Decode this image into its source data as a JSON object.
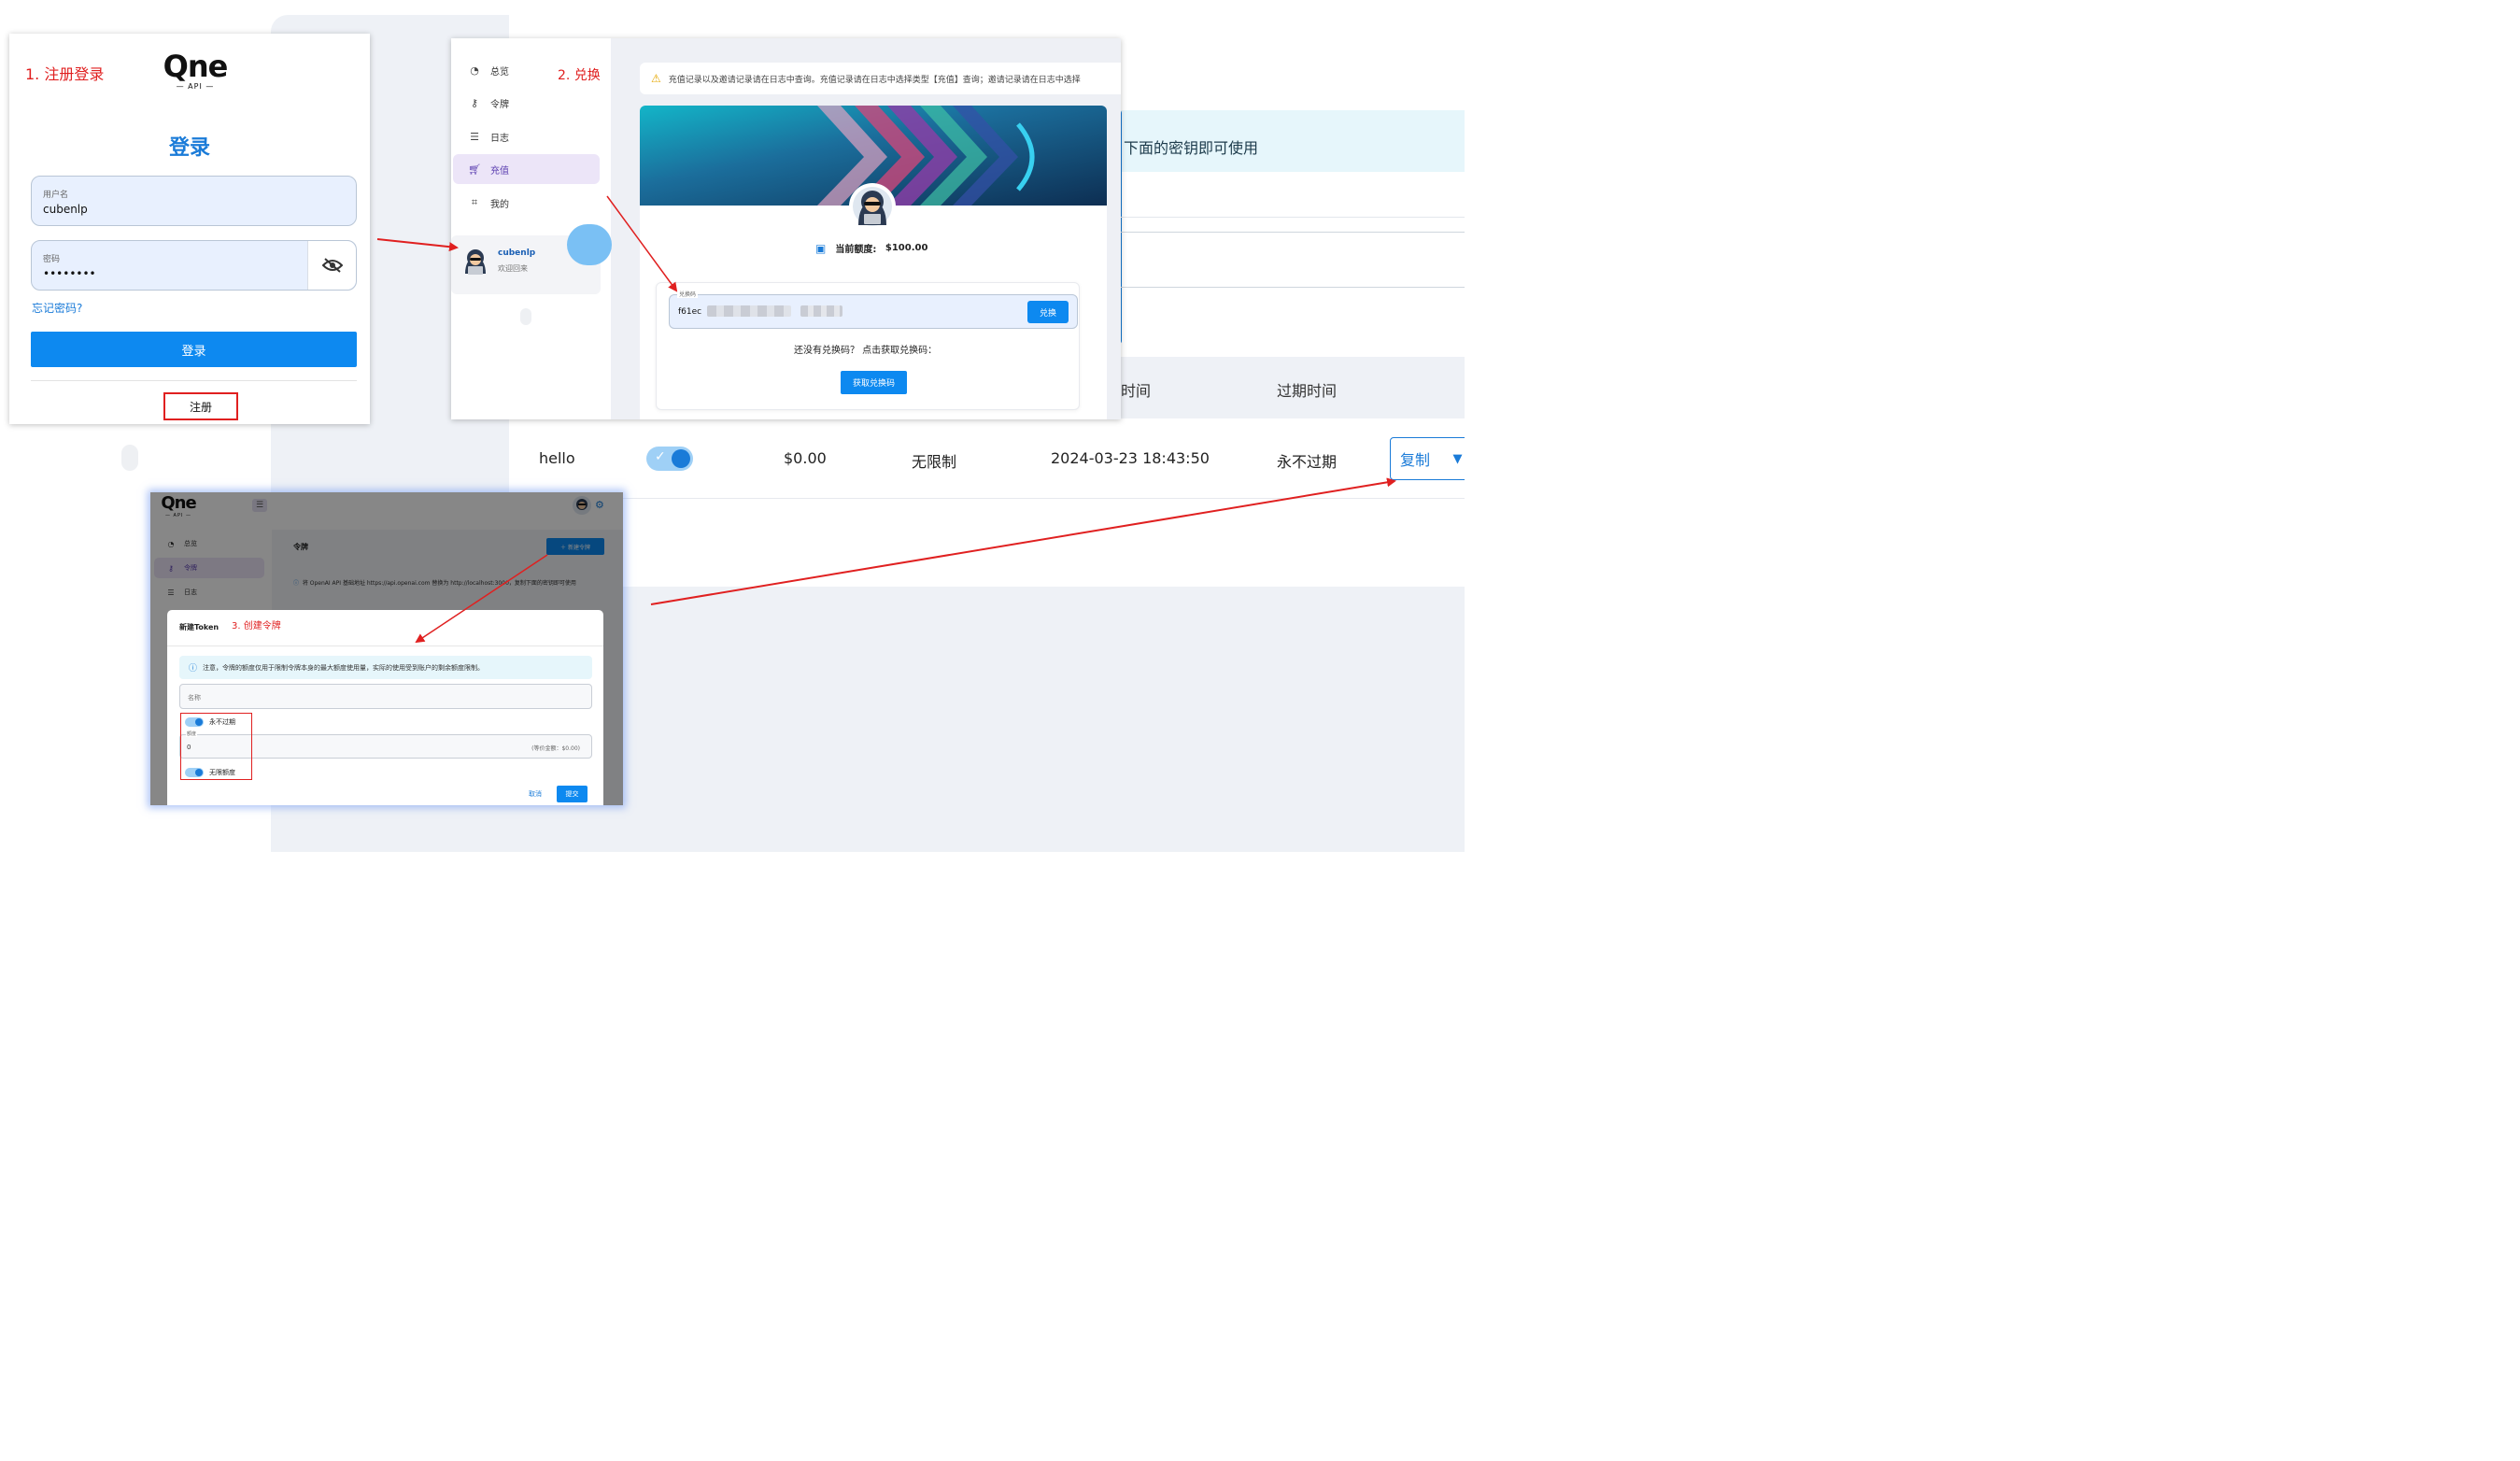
{
  "background": {
    "info_text": "下面的密钥即可使用",
    "table_headers": [
      "时间",
      "过期时间"
    ],
    "row": {
      "name": "hello",
      "used_quota": "$0.00",
      "remaining": "无限制",
      "created": "2024-03-23 18:43:50",
      "expires": "永不过期",
      "copy_label": "复制",
      "status_enabled": true
    }
  },
  "login": {
    "step": "1. 注册登录",
    "logo_text": "Qne",
    "logo_sub": "— API —",
    "title": "登录",
    "username_label": "用户名",
    "username_value": "cubenlp",
    "password_label": "密码",
    "password_value": "••••••••",
    "forgot": "忘记密码?",
    "login_button": "登录",
    "register": "注册"
  },
  "recharge": {
    "step": "2. 兑换",
    "nav": [
      "总览",
      "令牌",
      "日志",
      "充值",
      "我的"
    ],
    "nav_icons": [
      "dashboard-icon",
      "key-icon",
      "list-icon",
      "cart-icon",
      "user-scan-icon"
    ],
    "active_nav": "充值",
    "user_name": "cubenlp",
    "user_welcome": "欢迎回来",
    "notice": "充值记录以及邀请记录请在日志中查询。充值记录请在日志中选择类型【充值】查询；邀请记录请在日志中选择",
    "balance_label": "当前额度:",
    "balance_value": "$100.00",
    "code_label": "兑换码",
    "code_value": "f61ec",
    "redeem_button": "兑换",
    "no_code_text": "还没有兑换码？ 点击获取兑换码：",
    "get_code_button": "获取兑换码"
  },
  "token": {
    "logo_text": "Qne",
    "logo_sub": "— API —",
    "nav": [
      "总览",
      "令牌",
      "日志"
    ],
    "active_nav": "令牌",
    "page_title": "令牌",
    "new_button": "＋ 新建令牌",
    "info": "将 OpenAI API 基础地址 https://api.openai.com 替换为 http://localhost:3000，复制下面的密钥即可使用",
    "dialog_title": "新建Token",
    "step": "3. 创建令牌",
    "note": "注意，令牌的额度仅用于限制令牌本身的最大额度使用量，实际的使用受到账户的剩余额度限制。",
    "name_placeholder": "名称",
    "never_expire": "永不过期",
    "quota_label": "额度",
    "quota_value": "0",
    "quota_equiv": "(等价金额：$0.00)",
    "unlimited": "无限额度",
    "cancel": "取消",
    "submit": "提交"
  },
  "colors": {
    "primary": "#0d89f0",
    "annotation_red": "#e02020",
    "active_nav_bg": "#ece5f8",
    "field_bg": "#e8f0fe"
  }
}
